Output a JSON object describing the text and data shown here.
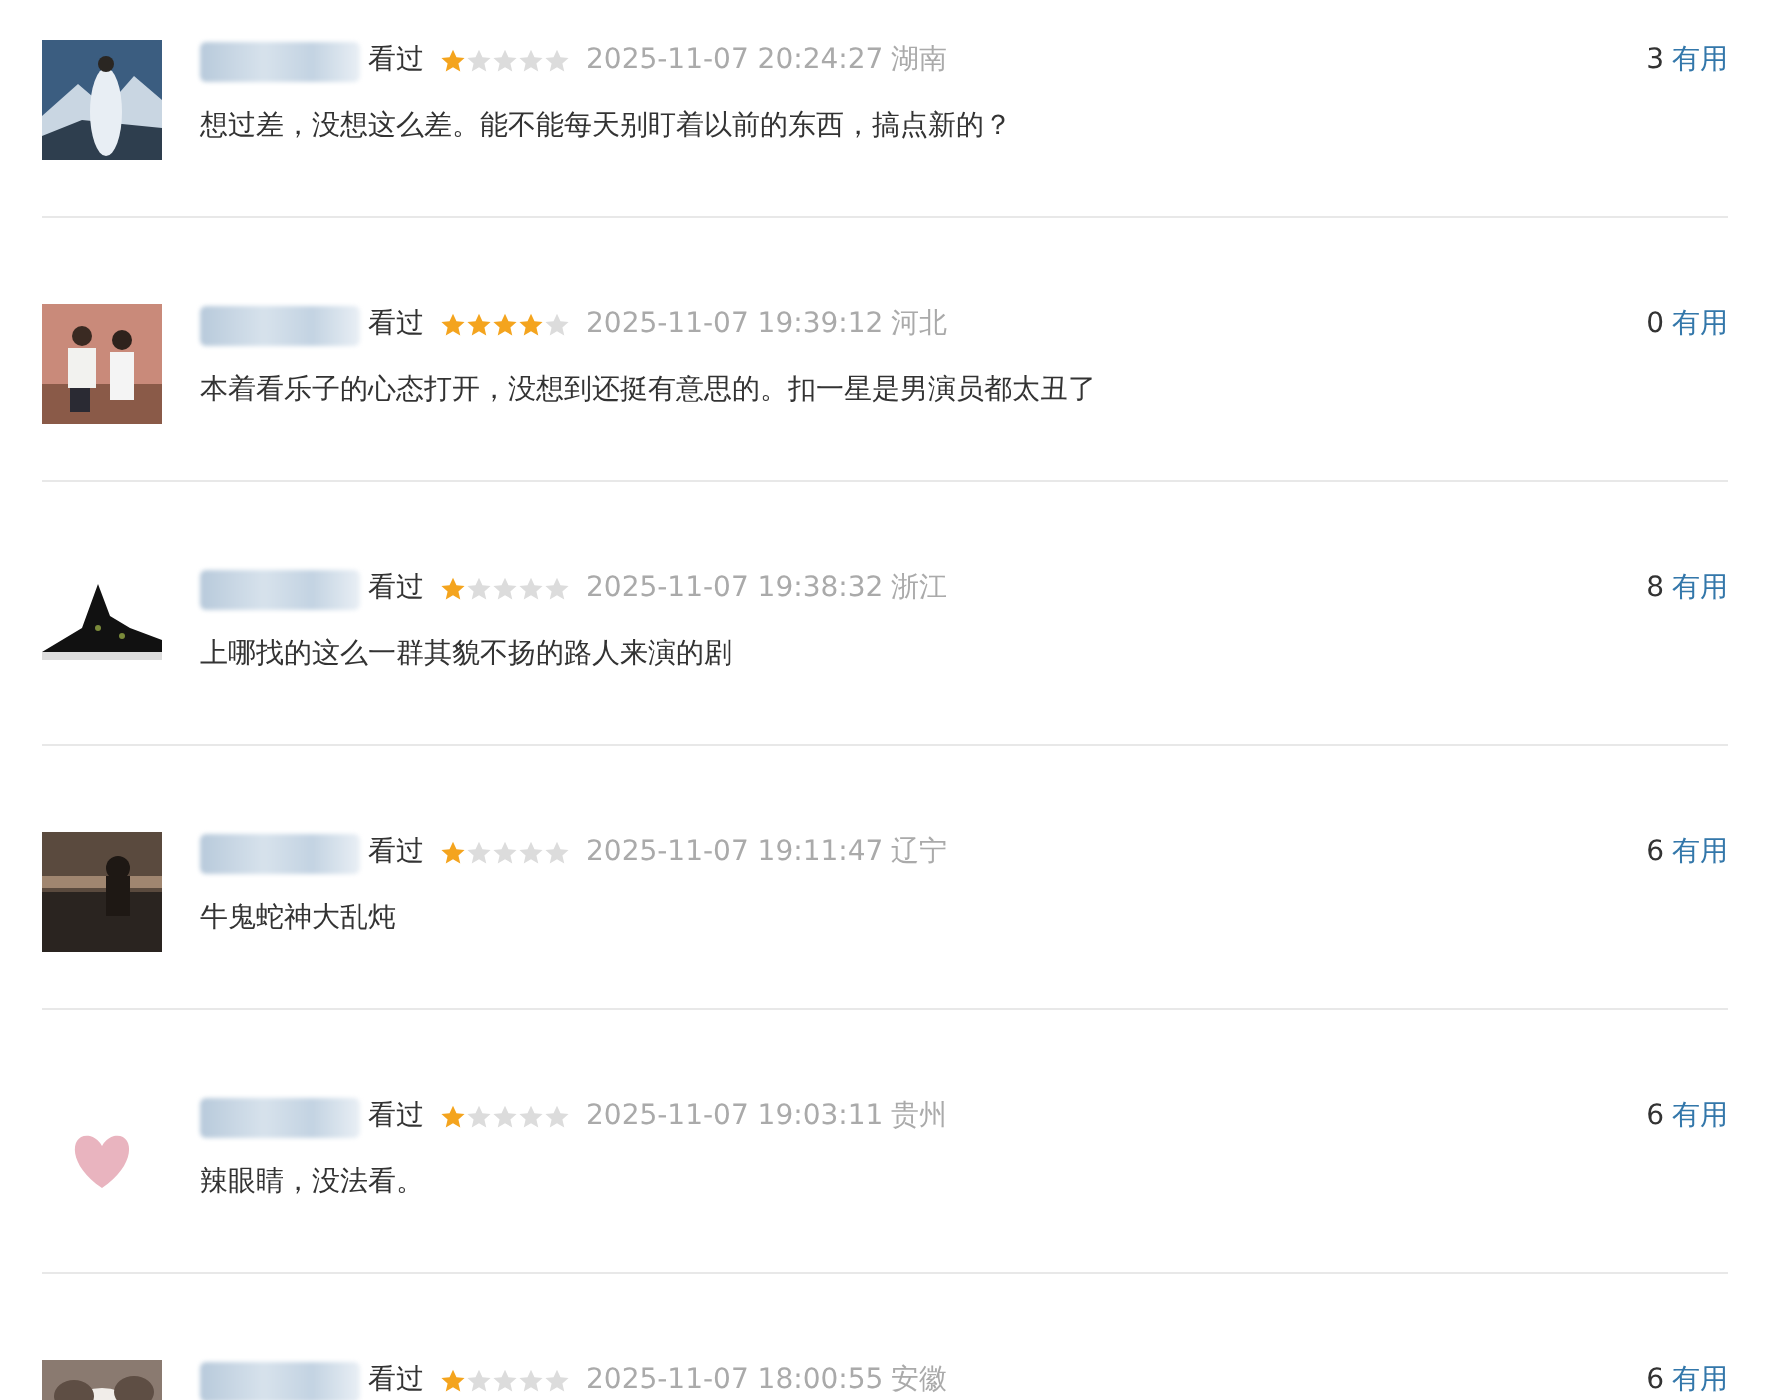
{
  "comments": [
    {
      "status": "看过",
      "stars": 1,
      "time": "2025-11-07 20:24:27",
      "region": "湖南",
      "text": "想过差，没想这么差。能不能每天别盯着以前的东西，搞点新的？",
      "votes": "3",
      "vote_label": "有用"
    },
    {
      "status": "看过",
      "stars": 4,
      "time": "2025-11-07 19:39:12",
      "region": "河北",
      "text": "本着看乐子的心态打开，没想到还挺有意思的。扣一星是男演员都太丑了",
      "votes": "0",
      "vote_label": "有用"
    },
    {
      "status": "看过",
      "stars": 1,
      "time": "2025-11-07 19:38:32",
      "region": "浙江",
      "text": "上哪找的这么一群其貌不扬的路人来演的剧",
      "votes": "8",
      "vote_label": "有用"
    },
    {
      "status": "看过",
      "stars": 1,
      "time": "2025-11-07 19:11:47",
      "region": "辽宁",
      "text": "牛鬼蛇神大乱炖",
      "votes": "6",
      "vote_label": "有用"
    },
    {
      "status": "看过",
      "stars": 1,
      "time": "2025-11-07 19:03:11",
      "region": "贵州",
      "text": "辣眼睛，没法看。",
      "votes": "6",
      "vote_label": "有用"
    },
    {
      "status": "看过",
      "stars": 1,
      "time": "2025-11-07 18:00:55",
      "region": "安徽",
      "votes": "6",
      "vote_label": "有用"
    }
  ]
}
